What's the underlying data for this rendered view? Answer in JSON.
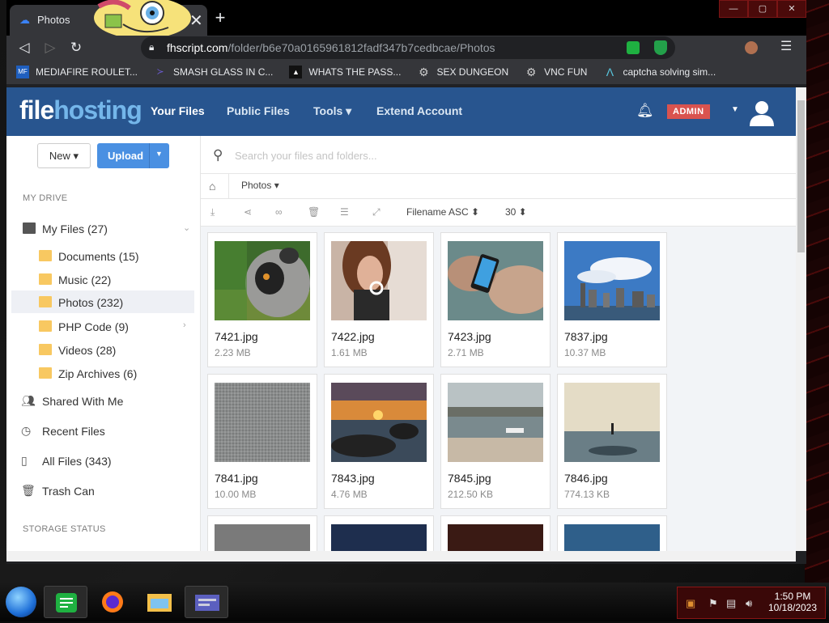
{
  "browser": {
    "tab_title": "Photos",
    "tab_close": "✕",
    "new_tab": "+",
    "url_host": "fhscript.com",
    "url_path": "/folder/b6e70a0165961812fadf347b7cedbcae/Photos",
    "bookmarks": [
      {
        "label": "MEDIAFIRE ROULET...",
        "icon": "MF",
        "color": "#1f5fbf"
      },
      {
        "label": "SMASH GLASS IN C...",
        "icon": "≻",
        "color": "#6a5acd"
      },
      {
        "label": "WHATS THE PASS...",
        "icon": "▲",
        "color": "#333333"
      },
      {
        "label": "SEX DUNGEON",
        "icon": "⚙",
        "color": "#cccccc"
      },
      {
        "label": "VNC FUN",
        "icon": "⚙",
        "color": "#cccccc"
      },
      {
        "label": "captcha solving sim...",
        "icon": "Λ",
        "color": "#58c4dc"
      }
    ]
  },
  "app": {
    "logo_a": "file",
    "logo_b": "hosting",
    "nav": {
      "your_files": "Your Files",
      "public_files": "Public Files",
      "tools": "Tools ▾",
      "extend": "Extend Account"
    },
    "admin_badge": "ADMIN"
  },
  "sidebar": {
    "new_label": "New ▾",
    "upload_label": "Upload",
    "my_drive": "MY DRIVE",
    "my_files": "My Files (27)",
    "folders": [
      {
        "label": "Documents (15)"
      },
      {
        "label": "Music (22)"
      },
      {
        "label": "Photos (232)"
      },
      {
        "label": "PHP Code (9)"
      },
      {
        "label": "Videos (28)"
      },
      {
        "label": "Zip Archives (6)"
      }
    ],
    "shared": "Shared With Me",
    "recent": "Recent Files",
    "all_files": "All Files (343)",
    "trash": "Trash Can",
    "storage_status": "STORAGE STATUS"
  },
  "main": {
    "search_placeholder": "Search your files and folders...",
    "breadcrumb_current": "Photos ▾",
    "sort_label": "Filename ASC ⬍",
    "per_page": "30 ⬍",
    "files": [
      {
        "name": "7421.jpg",
        "size": "2.23 MB"
      },
      {
        "name": "7422.jpg",
        "size": "1.61 MB"
      },
      {
        "name": "7423.jpg",
        "size": "2.71 MB"
      },
      {
        "name": "7837.jpg",
        "size": "10.37 MB"
      },
      {
        "name": "7841.jpg",
        "size": "10.00 MB"
      },
      {
        "name": "7843.jpg",
        "size": "4.76 MB"
      },
      {
        "name": "7845.jpg",
        "size": "212.50 KB"
      },
      {
        "name": "7846.jpg",
        "size": "774.13 KB"
      }
    ]
  },
  "taskbar": {
    "time": "1:50 PM",
    "date": "10/18/2023"
  }
}
